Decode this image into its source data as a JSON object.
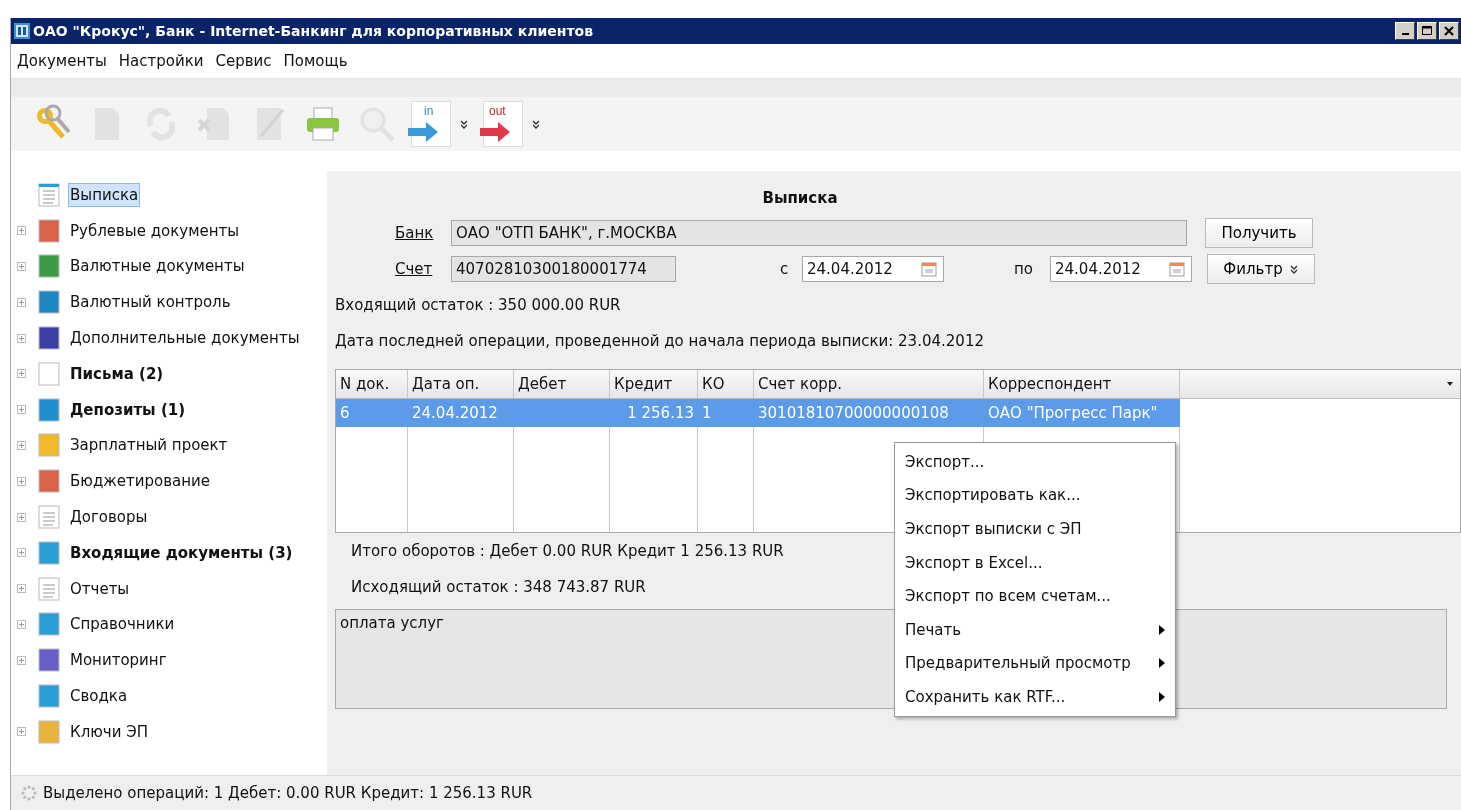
{
  "window": {
    "title": "ОАО \"Крокус\", Банк - Internet-Банкинг для корпоративных клиентов"
  },
  "menu": [
    "Документы",
    "Настройки",
    "Сервис",
    "Помощь"
  ],
  "toolbar": [
    {
      "kind": "keys",
      "disabled": false
    },
    {
      "kind": "new",
      "disabled": true
    },
    {
      "kind": "refresh",
      "disabled": true
    },
    {
      "kind": "delete",
      "disabled": true
    },
    {
      "kind": "edit",
      "disabled": true
    },
    {
      "kind": "print",
      "disabled": false
    },
    {
      "kind": "search",
      "disabled": true
    },
    {
      "kind": "import",
      "disabled": false,
      "label": "in"
    },
    {
      "kind": "export",
      "disabled": false,
      "label": "out"
    }
  ],
  "sidebar": {
    "items": [
      {
        "label": "Выписка",
        "expandable": false,
        "bold": false,
        "selected": true
      },
      {
        "label": "Рублевые документы",
        "expandable": true,
        "bold": false,
        "selected": false
      },
      {
        "label": "Валютные документы",
        "expandable": true,
        "bold": false,
        "selected": false
      },
      {
        "label": "Валютный контроль",
        "expandable": true,
        "bold": false,
        "selected": false
      },
      {
        "label": "Дополнительные документы",
        "expandable": true,
        "bold": false,
        "selected": false
      },
      {
        "label": "Письма (2)",
        "expandable": true,
        "bold": true,
        "selected": false
      },
      {
        "label": "Депозиты (1)",
        "expandable": true,
        "bold": true,
        "selected": false
      },
      {
        "label": "Зарплатный проект",
        "expandable": true,
        "bold": false,
        "selected": false
      },
      {
        "label": "Бюджетирование",
        "expandable": true,
        "bold": false,
        "selected": false
      },
      {
        "label": "Договоры",
        "expandable": true,
        "bold": false,
        "selected": false
      },
      {
        "label": "Входящие документы (3)",
        "expandable": true,
        "bold": true,
        "selected": false
      },
      {
        "label": "Отчеты",
        "expandable": true,
        "bold": false,
        "selected": false
      },
      {
        "label": "Справочники",
        "expandable": true,
        "bold": false,
        "selected": false
      },
      {
        "label": "Мониторинг",
        "expandable": true,
        "bold": false,
        "selected": false
      },
      {
        "label": "Сводка",
        "expandable": false,
        "bold": false,
        "selected": false
      },
      {
        "label": "Ключи ЭП",
        "expandable": true,
        "bold": false,
        "selected": false
      }
    ]
  },
  "statement": {
    "title": "Выписка",
    "bank_label": "Банк",
    "bank_value": "ОАО \"ОТП БАНК\", г.МОСКВА",
    "get_button": "Получить",
    "account_label": "Счет",
    "account_value": "40702810300180001774",
    "from_label": "с",
    "from_date": "24.04.2012",
    "to_label": "по",
    "to_date": "24.04.2012",
    "filter_button": "Фильтр",
    "opening_balance": "Входящий остаток :  350 000.00  RUR",
    "last_operation": "Дата последней операции, проведенной до начала периода выписки: 23.04.2012"
  },
  "table": {
    "columns": [
      "N док.",
      "Дата оп.",
      "Дебет",
      "Кредит",
      "КО",
      "Счет корр.",
      "Корреспондент"
    ],
    "rows": [
      {
        "selected": true,
        "cells": [
          "6",
          "24.04.2012",
          "",
          "1 256.13",
          "1",
          "30101810700000000108",
          "ОАО \"Прогресс Парк\""
        ]
      }
    ]
  },
  "totals": {
    "turnover": "Итого оборотов :  Дебет  0.00  RUR  Кредит  1 256.13  RUR",
    "closing_balance": "Исходящий остаток :  348 743.87  RUR"
  },
  "purpose": "оплата услуг",
  "context_menu": [
    {
      "label": "Экспорт...",
      "submenu": false
    },
    {
      "label": "Экспортировать как...",
      "submenu": false
    },
    {
      "label": "Экспорт выписки с ЭП",
      "submenu": false
    },
    {
      "label": "Экспорт в Excel...",
      "submenu": false
    },
    {
      "label": "Экспорт по всем счетам...",
      "submenu": false
    },
    {
      "label": "Печать",
      "submenu": true
    },
    {
      "label": "Предварительный просмотр",
      "submenu": true
    },
    {
      "label": "Сохранить как RTF...",
      "submenu": true
    }
  ],
  "status_bar": "Выделено операций: 1 Дебет: 0.00 RUR Кредит: 1 256.13 RUR"
}
